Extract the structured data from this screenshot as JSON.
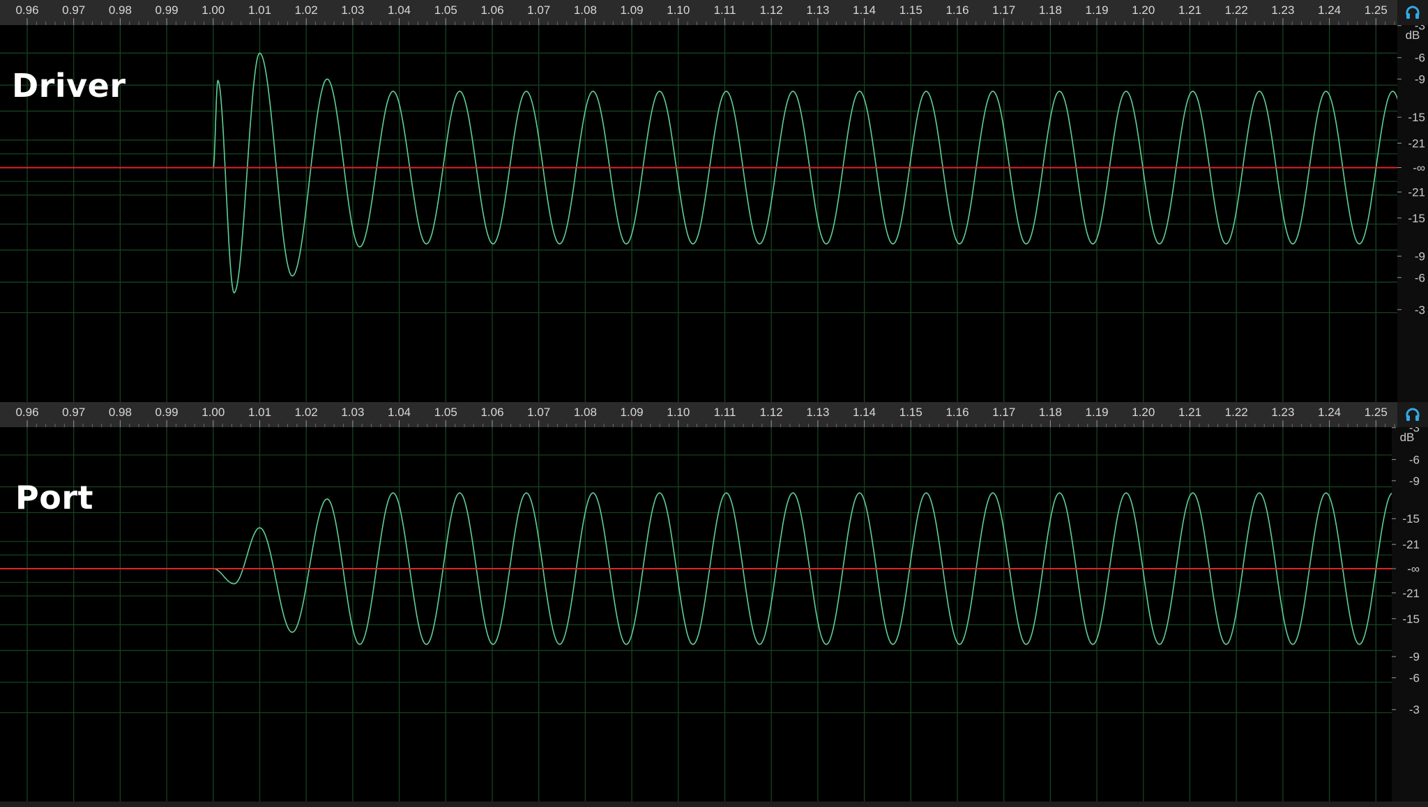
{
  "ruler": {
    "ticks": [
      "0.96",
      "0.97",
      "0.98",
      "0.99",
      "1.00",
      "1.01",
      "1.02",
      "1.03",
      "1.04",
      "1.05",
      "1.06",
      "1.07",
      "1.08",
      "1.09",
      "1.10",
      "1.11",
      "1.12",
      "1.13",
      "1.14",
      "1.15",
      "1.16",
      "1.17",
      "1.18",
      "1.19",
      "1.20",
      "1.21",
      "1.22",
      "1.23",
      "1.24",
      "1.25"
    ]
  },
  "tracks": [
    {
      "label": "Driver",
      "scale_unit": "dB",
      "scale_labels": [
        "-3",
        "-6",
        "-9",
        "-15",
        "-21",
        "-∞",
        "-21",
        "-15",
        "-9",
        "-6",
        "-3"
      ],
      "waveform": {
        "onset_time": 1.0,
        "steady_period": 0.01433,
        "steady_peak": 0.5,
        "transient_peaks": [
          {
            "time": 1.001,
            "value": 0.57
          },
          {
            "time": 1.0045,
            "value": -0.82
          },
          {
            "time": 1.01,
            "value": 0.75
          },
          {
            "time": 1.017,
            "value": -0.71
          },
          {
            "time": 1.0245,
            "value": 0.58
          },
          {
            "time": 1.0315,
            "value": -0.52
          }
        ]
      }
    },
    {
      "label": "Port",
      "scale_unit": "dB",
      "scale_labels": [
        "-3",
        "-6",
        "-9",
        "-15",
        "-21",
        "-∞",
        "-21",
        "-15",
        "-9",
        "-6",
        "-3"
      ],
      "waveform": {
        "onset_time": 1.0,
        "steady_period": 0.01433,
        "steady_peak": 0.5,
        "transient_peaks": [
          {
            "time": 1.0045,
            "value": -0.1
          },
          {
            "time": 1.01,
            "value": 0.27
          },
          {
            "time": 1.017,
            "value": -0.42
          },
          {
            "time": 1.0245,
            "value": 0.46
          },
          {
            "time": 1.0315,
            "value": -0.5
          }
        ]
      }
    }
  ],
  "colors": {
    "waveform": "#5fcf96",
    "centerline": "#e0242a",
    "grid": "#16431f",
    "ruler_bg": "#2b2b2b",
    "headphone_icon": "#33a9e6"
  },
  "icons": {
    "monitor": "headphones-icon"
  }
}
